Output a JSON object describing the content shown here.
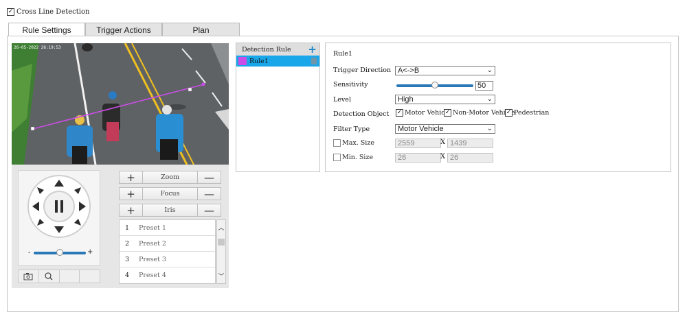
{
  "header": {
    "enable_label": "Cross Line Detection",
    "enabled": true
  },
  "tabs": [
    {
      "label": "Rule Settings",
      "active": true
    },
    {
      "label": "Trigger Actions",
      "active": false
    },
    {
      "label": "Plan",
      "active": false
    }
  ],
  "video": {
    "timestamp": "26-05-2022 26:19:53"
  },
  "ptz": {
    "zoom_label": "Zoom",
    "focus_label": "Focus",
    "iris_label": "Iris",
    "plus_glyph": "+",
    "minus_glyph": "—",
    "speed_min": "-",
    "speed_max": "+",
    "speed_level": 0.5,
    "presets": [
      {
        "num": "1",
        "name": "Preset 1"
      },
      {
        "num": "2",
        "name": "Preset 2"
      },
      {
        "num": "3",
        "name": "Preset 3"
      },
      {
        "num": "4",
        "name": "Preset 4"
      }
    ]
  },
  "rules": {
    "header": "Detection Rule",
    "add_glyph": "+",
    "items": [
      {
        "name": "Rule1",
        "color": "#c94de6",
        "selected": true
      }
    ]
  },
  "settings": {
    "rule_name": "Rule1",
    "trigger_direction_label": "Trigger Direction",
    "trigger_direction_value": "A<->B",
    "sensitivity_label": "Sensitivity",
    "sensitivity_value": "50",
    "sensitivity_level": 0.5,
    "level_label": "Level",
    "level_value": "High",
    "detection_object_label": "Detection Object",
    "objects": [
      {
        "label": "Motor Vehicle",
        "checked": true
      },
      {
        "label": "Non-Motor Vehicle",
        "checked": true
      },
      {
        "label": "Pedestrian",
        "checked": true
      }
    ],
    "filter_type_label": "Filter Type",
    "filter_type_value": "Motor Vehicle",
    "max_size_label": "Max. Size",
    "max_w": "2559",
    "max_h": "1439",
    "min_size_label": "Min. Size",
    "min_w": "26",
    "min_h": "26",
    "x_label": "X",
    "check_glyph": "✓"
  },
  "colors": {
    "accent": "#1aa7ea",
    "rule_line": "#c94de6",
    "slider": "#2a78b5"
  }
}
